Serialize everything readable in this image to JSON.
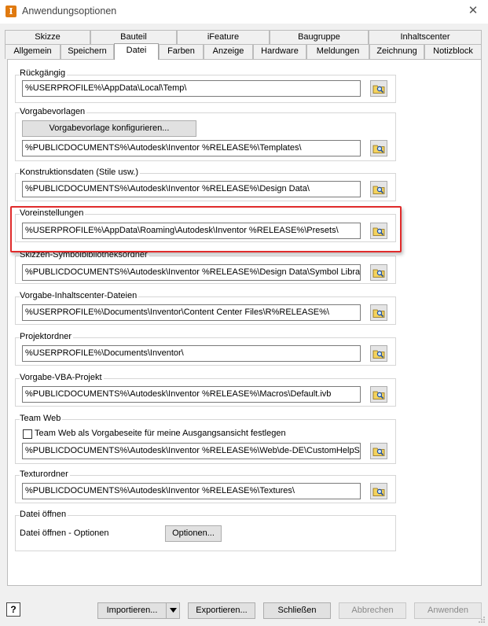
{
  "window": {
    "title": "Anwendungsoptionen",
    "app_icon_letter": "I",
    "close_glyph": "✕"
  },
  "tabs_row1": [
    "Skizze",
    "Bauteil",
    "iFeature",
    "Baugruppe",
    "Inhaltscenter"
  ],
  "tabs_row2": [
    "Allgemein",
    "Speichern",
    "Datei",
    "Farben",
    "Anzeige",
    "Hardware",
    "Meldungen",
    "Zeichnung",
    "Notizblock"
  ],
  "active_tab": "Datei",
  "groups": {
    "undo": {
      "label": "Rückgängig",
      "path": "%USERPROFILE%\\AppData\\Local\\Temp\\"
    },
    "templates": {
      "label": "Vorgabevorlagen",
      "configure_button": "Vorgabevorlage konfigurieren...",
      "path": "%PUBLICDOCUMENTS%\\Autodesk\\Inventor %RELEASE%\\Templates\\"
    },
    "design_data": {
      "label": "Konstruktionsdaten (Stile usw.)",
      "path": "%PUBLICDOCUMENTS%\\Autodesk\\Inventor %RELEASE%\\Design Data\\"
    },
    "presets": {
      "label": "Voreinstellungen",
      "path": "%USERPROFILE%\\AppData\\Roaming\\Autodesk\\Inventor %RELEASE%\\Presets\\"
    },
    "sketch_symbols": {
      "label": "Skizzen-Symbolbibliotheksordner",
      "path": "%PUBLICDOCUMENTS%\\Autodesk\\Inventor %RELEASE%\\Design Data\\Symbol Library\\"
    },
    "content_center": {
      "label": "Vorgabe-Inhaltscenter-Dateien",
      "path": "%USERPROFILE%\\Documents\\Inventor\\Content Center Files\\R%RELEASE%\\"
    },
    "project_folder": {
      "label": "Projektordner",
      "path": "%USERPROFILE%\\Documents\\Inventor\\"
    },
    "vba_project": {
      "label": "Vorgabe-VBA-Projekt",
      "path": "%PUBLICDOCUMENTS%\\Autodesk\\Inventor %RELEASE%\\Macros\\Default.ivb"
    },
    "team_web": {
      "label": "Team Web",
      "checkbox_label": "Team Web als Vorgabeseite für meine Ausgangsansicht festlegen",
      "checked": false,
      "path": "%PUBLICDOCUMENTS%\\Autodesk\\Inventor %RELEASE%\\Web\\de-DE\\CustomHelpSample"
    },
    "textures": {
      "label": "Texturordner",
      "path": "%PUBLICDOCUMENTS%\\Autodesk\\Inventor %RELEASE%\\Textures\\"
    },
    "file_open": {
      "label": "Datei öffnen",
      "options_label": "Datei öffnen - Optionen",
      "options_button": "Optionen..."
    }
  },
  "footer": {
    "help_glyph": "?",
    "import_button": "Importieren...",
    "export_button": "Exportieren...",
    "close_button": "Schließen",
    "cancel_button": "Abbrechen",
    "apply_button": "Anwenden"
  },
  "colors": {
    "highlight_border": "#e02b2b",
    "app_icon": "#e07a10"
  }
}
